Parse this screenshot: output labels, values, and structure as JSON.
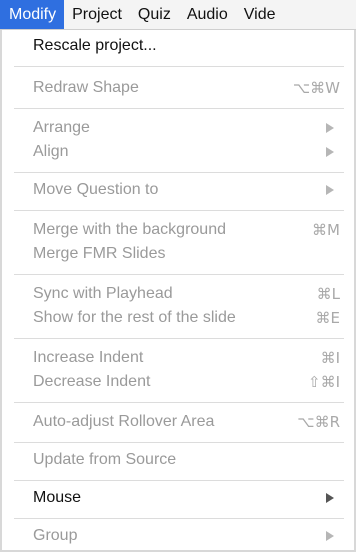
{
  "menubar": {
    "items": [
      {
        "label": "Modify",
        "active": true
      },
      {
        "label": "Project"
      },
      {
        "label": "Quiz"
      },
      {
        "label": "Audio"
      },
      {
        "label": "Vide"
      }
    ]
  },
  "menu": {
    "items": [
      {
        "label": "Rescale project...",
        "enabled": true
      },
      {
        "label": "Redraw Shape",
        "shortcut": "⌥⌘W",
        "enabled": false
      },
      {
        "label": "Arrange",
        "submenu": true,
        "enabled": false
      },
      {
        "label": "Align",
        "submenu": true,
        "enabled": false
      },
      {
        "label": "Move Question to",
        "submenu": true,
        "enabled": false
      },
      {
        "label": "Merge with the background",
        "shortcut": "⌘M",
        "enabled": false
      },
      {
        "label": "Merge FMR Slides",
        "enabled": false
      },
      {
        "label": "Sync with Playhead",
        "shortcut": "⌘L",
        "enabled": false
      },
      {
        "label": "Show for the rest of the slide",
        "shortcut": "⌘E",
        "enabled": false
      },
      {
        "label": "Increase Indent",
        "shortcut": "⌘I",
        "enabled": false
      },
      {
        "label": "Decrease Indent",
        "shortcut": "⇧⌘I",
        "enabled": false
      },
      {
        "label": "Auto-adjust Rollover Area",
        "shortcut": "⌥⌘R",
        "enabled": false
      },
      {
        "label": "Update from Source",
        "enabled": false
      },
      {
        "label": "Mouse",
        "submenu": true,
        "enabled": true
      },
      {
        "label": "Group",
        "submenu": true,
        "enabled": false
      }
    ]
  },
  "colors": {
    "accent": "#2f6fe0",
    "enabled_text": "#111111",
    "disabled_text": "#9a9a9a"
  },
  "icons": {
    "submenu": "chevron-right-icon"
  }
}
